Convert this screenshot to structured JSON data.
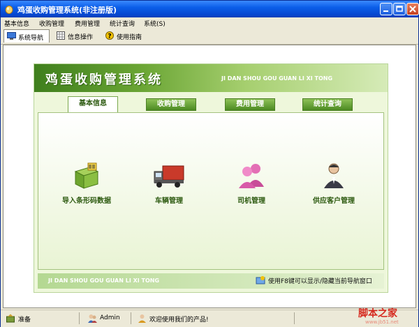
{
  "window": {
    "title": "鸡蛋收购管理系统(非注册版)"
  },
  "menubar": {
    "items": [
      "基本信息",
      "收购管理",
      "费用管理",
      "统计查询",
      "系统(S)"
    ]
  },
  "navbar": {
    "tabs": [
      {
        "label": "系统导航",
        "icon": "monitor-icon",
        "active": true
      },
      {
        "label": "信息操作",
        "icon": "grid-icon",
        "active": false
      },
      {
        "label": "使用指南",
        "icon": "help-icon",
        "active": false
      }
    ]
  },
  "banner": {
    "title": "鸡蛋收购管理系统",
    "subtitle": "JI DAN SHOU GOU GUAN LI XI TONG"
  },
  "panel_tabs": [
    {
      "label": "基本信息",
      "active": true
    },
    {
      "label": "收购管理",
      "active": false
    },
    {
      "label": "费用管理",
      "active": false
    },
    {
      "label": "统计查询",
      "active": false
    }
  ],
  "features": [
    {
      "label": "导入条形码数据",
      "icon": "barcode-box-icon"
    },
    {
      "label": "车辆管理",
      "icon": "truck-icon"
    },
    {
      "label": "司机管理",
      "icon": "people-icon"
    },
    {
      "label": "供应客户管理",
      "icon": "customer-icon"
    }
  ],
  "footer": {
    "subtitle": "JI DAN SHOU GOU GUAN LI XI TONG",
    "hint": "使用F8键可以显示/隐藏当前导航窗口"
  },
  "statusbar": {
    "status": "准备",
    "user": "Admin",
    "welcome": "欢迎使用我们的产品!"
  },
  "watermark": {
    "text": "脚本之家",
    "url": "www.jb51.net"
  },
  "colors": {
    "title_bar": "#0b5ee8",
    "accent_green": "#4c8a22",
    "panel_bg": "#eef7db"
  }
}
